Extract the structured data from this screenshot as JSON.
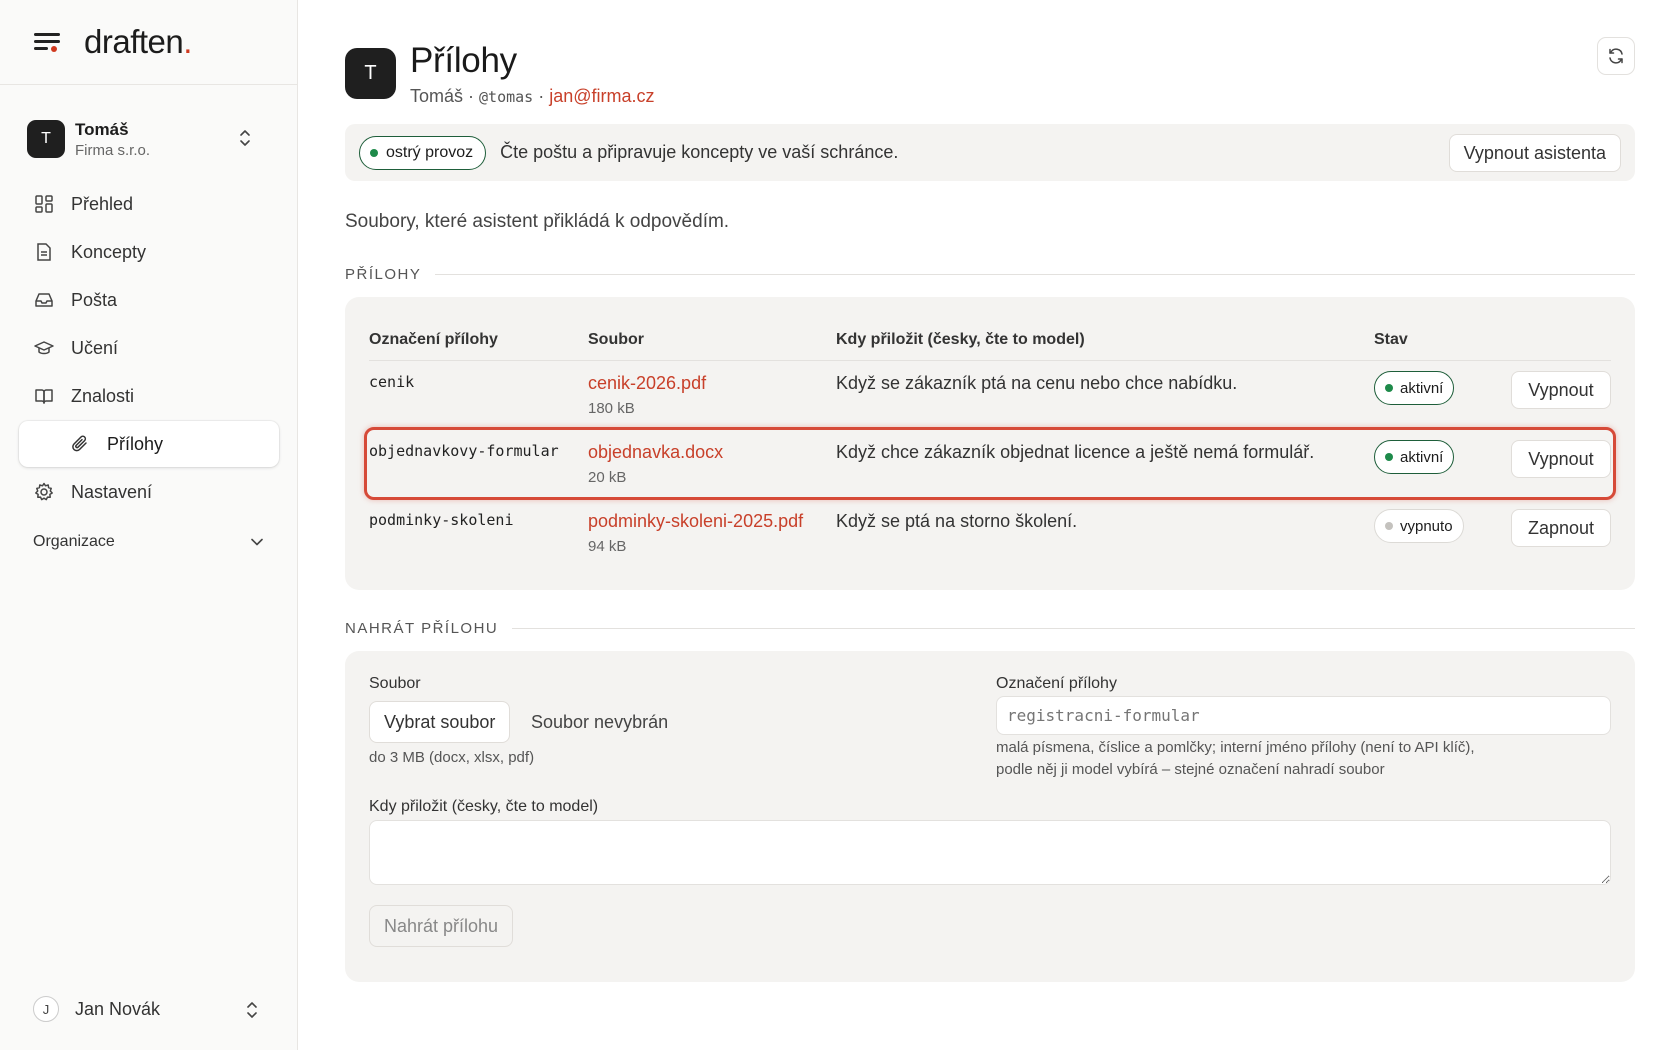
{
  "brand": {
    "logo_text": "draften",
    "logo_dot": ".",
    "accent": "#d0391f"
  },
  "account": {
    "initial": "T",
    "name": "Tomáš",
    "org": "Firma s.r.o."
  },
  "nav": {
    "items": [
      {
        "label": "Přehled",
        "icon": "dashboard-icon"
      },
      {
        "label": "Koncepty",
        "icon": "document-icon"
      },
      {
        "label": "Pošta",
        "icon": "inbox-icon"
      },
      {
        "label": "Učení",
        "icon": "graduation-cap-icon"
      },
      {
        "label": "Znalosti",
        "icon": "book-icon"
      },
      {
        "label": "Přílohy",
        "icon": "paperclip-icon",
        "active": true
      },
      {
        "label": "Nastavení",
        "icon": "gear-icon"
      }
    ],
    "org_label": "Organizace"
  },
  "user": {
    "initial": "J",
    "name": "Jan Novák"
  },
  "header": {
    "avatar_initial": "T",
    "title": "Přílohy",
    "name": "Tomáš",
    "sep1": " · ",
    "handle": "@tomas",
    "sep2": " · ",
    "email": "jan@firma.cz"
  },
  "banner": {
    "status_label": "ostrý provoz",
    "text": "Čte poštu a připravuje koncepty ve vaší schránce.",
    "button_label": "Vypnout asistenta"
  },
  "description": "Soubory, které asistent přikládá k odpovědím.",
  "attachments": {
    "section_label": "PŘÍLOHY",
    "columns": [
      "Označení přílohy",
      "Soubor",
      "Kdy přiložit (česky, čte to model)",
      "Stav"
    ],
    "rows": [
      {
        "label": "cenik",
        "file": "cenik-2026.pdf",
        "size": "180 kB",
        "when": "Když se zákazník ptá na cenu nebo chce nabídku.",
        "status": "aktivní",
        "active": true,
        "action": "Vypnout"
      },
      {
        "label": "objednavkovy-formular",
        "file": "objednavka.docx",
        "size": "20 kB",
        "when": "Když chce zákazník objednat licence a ještě nemá formulář.",
        "status": "aktivní",
        "active": true,
        "action": "Vypnout",
        "highlighted": true
      },
      {
        "label": "podminky-skoleni",
        "file": "podminky-skoleni-2025.pdf",
        "size": "94 kB",
        "when": "Když se ptá na storno školení.",
        "status": "vypnuto",
        "active": false,
        "action": "Zapnout"
      }
    ]
  },
  "upload": {
    "section_label": "NAHRÁT PŘÍLOHU",
    "file_label": "Soubor",
    "choose_button": "Vybrat soubor",
    "no_file": "Soubor nevybrán",
    "file_hint": "do 3 MB (docx, xlsx, pdf)",
    "name_label": "Označení přílohy",
    "name_placeholder": "registracni-formular",
    "name_hint_1": "malá písmena, číslice a pomlčky; interní jméno přílohy (není to API klíč),",
    "name_hint_2": "podle něj ji model vybírá – stejné označení nahradí soubor",
    "when_label": "Kdy přiložit (česky, čte to model)",
    "when_value": "",
    "submit_label": "Nahrát přílohu"
  }
}
